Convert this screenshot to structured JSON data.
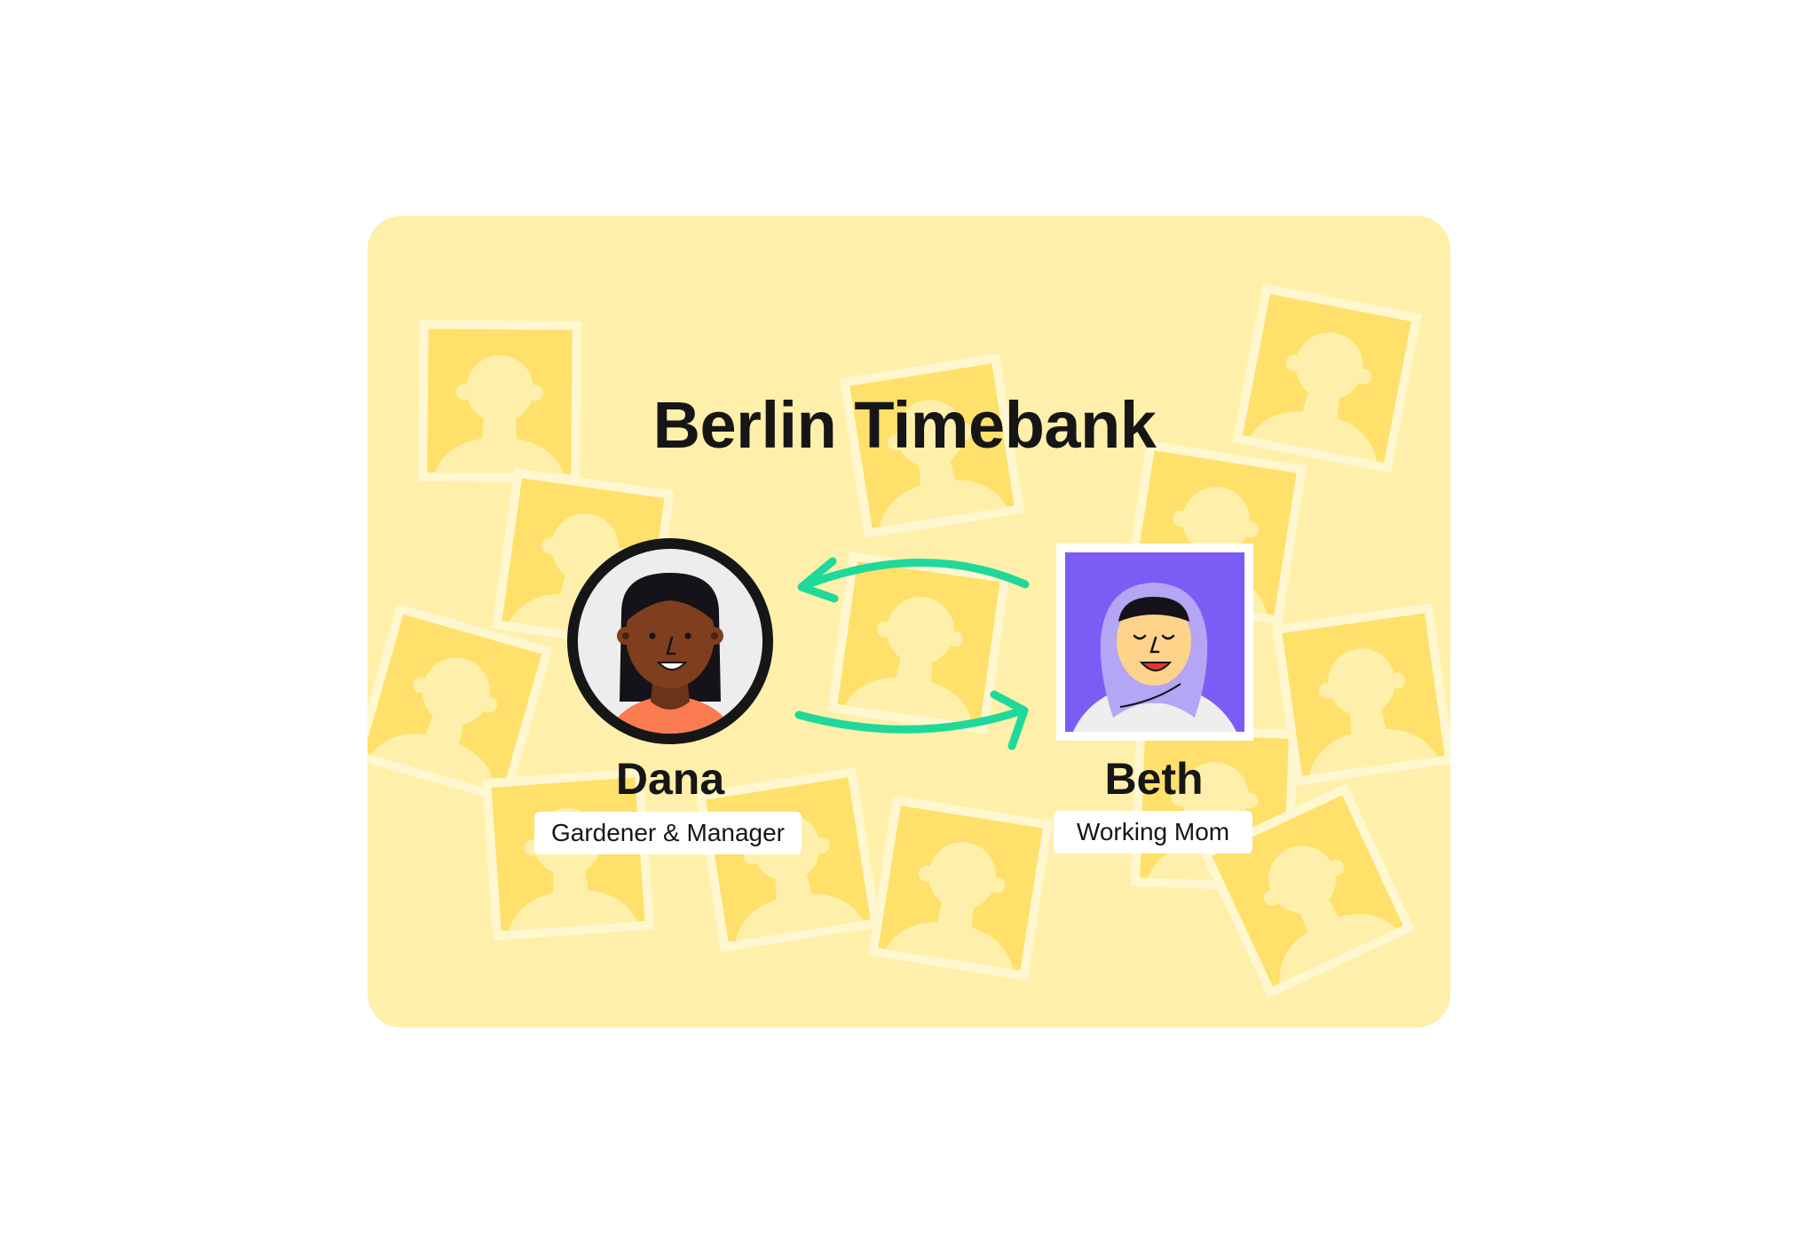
{
  "title": "Berlin Timebank",
  "colors": {
    "card_bg": "#fef0aa",
    "photo_fill": "#fee06a",
    "photo_frame": "#fff7cf",
    "arrow": "#1ed99a",
    "beth_bg": "#7b5cf5",
    "dana_bg": "#ededed"
  },
  "members": [
    {
      "name": "Dana",
      "role": "Gardener & Manager",
      "avatar": "woman-avatar-icon"
    },
    {
      "name": "Beth",
      "role": "Working Mom",
      "avatar": "woman-hijab-avatar-icon"
    }
  ],
  "connector": "exchange-arrows-icon"
}
